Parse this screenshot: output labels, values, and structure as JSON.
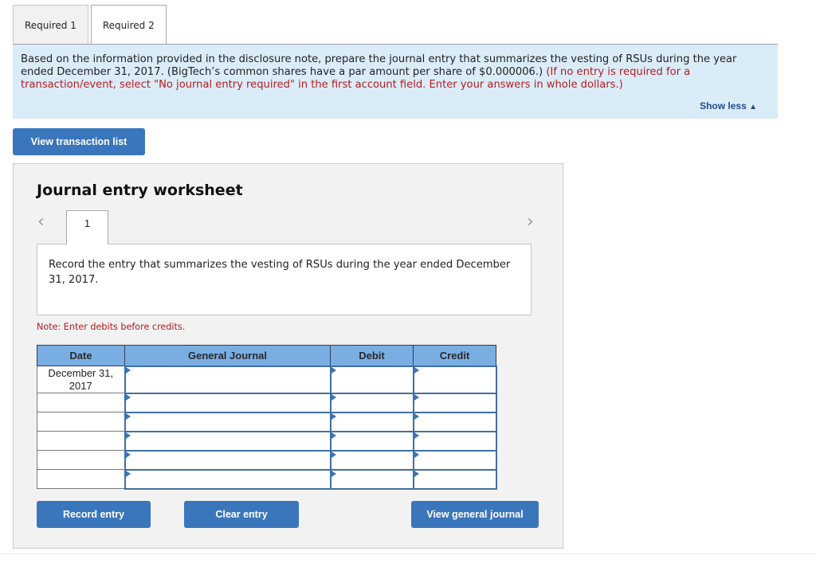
{
  "tabs": [
    {
      "label": "Required 1",
      "active": false
    },
    {
      "label": "Required 2",
      "active": true
    }
  ],
  "instructions": {
    "text": "Based on the information provided in the disclosure note, prepare the journal entry that summarizes the vesting of RSUs during the year ended December 31, 2017. (BigTech’s common shares have a par amount per share of $0.000006.) ",
    "warning": "(If no entry is required for a transaction/event, select \"No journal entry required\" in the first account field. Enter your answers in whole dollars.)",
    "show_less_label": "Show less",
    "show_less_icon": "▲"
  },
  "view_transaction_list_label": "View transaction list",
  "worksheet": {
    "title": "Journal entry worksheet",
    "prev_icon": "‹",
    "next_icon": "›",
    "entry_number": "1",
    "entry_description": "Record the entry that summarizes the vesting of RSUs during the year ended December 31, 2017.",
    "note": "Note: Enter debits before credits.",
    "columns": [
      "Date",
      "General Journal",
      "Debit",
      "Credit"
    ],
    "rows": [
      {
        "date": "December 31, 2017",
        "account": "",
        "debit": "",
        "credit": ""
      },
      {
        "date": "",
        "account": "",
        "debit": "",
        "credit": ""
      },
      {
        "date": "",
        "account": "",
        "debit": "",
        "credit": ""
      },
      {
        "date": "",
        "account": "",
        "debit": "",
        "credit": ""
      },
      {
        "date": "",
        "account": "",
        "debit": "",
        "credit": ""
      },
      {
        "date": "",
        "account": "",
        "debit": "",
        "credit": ""
      }
    ],
    "record_entry_label": "Record entry",
    "clear_entry_label": "Clear entry",
    "view_general_journal_label": "View general journal"
  },
  "colors": {
    "button": "#3a76bb",
    "table_header": "#7aaee3",
    "instructions_bg": "#dbecf9",
    "warning_text": "#b51d1d"
  }
}
